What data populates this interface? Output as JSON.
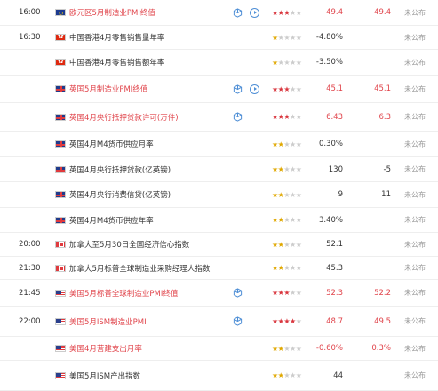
{
  "colors": {
    "accent_red": "#e0434a",
    "star_red": "#d9363e",
    "star_yellow": "#e0a800",
    "icon_blue": "#4f8fd6"
  },
  "rows": [
    {
      "time": "16:00",
      "flag": "eu",
      "name": "欧元区5月制造业PMI终值",
      "highlight": true,
      "icons": [
        "cube",
        "play"
      ],
      "stars": 3,
      "star_color": "red",
      "prev": "49.4",
      "fore": "49.4",
      "actual": "未公布"
    },
    {
      "time": "16:30",
      "flag": "hk",
      "name": "中国香港4月零售销售量年率",
      "highlight": false,
      "icons": [],
      "stars": 1,
      "star_color": "yellow",
      "prev": "-4.80%",
      "fore": "",
      "actual": "未公布"
    },
    {
      "time": "",
      "flag": "hk",
      "name": "中国香港4月零售销售额年率",
      "highlight": false,
      "icons": [],
      "stars": 1,
      "star_color": "yellow",
      "prev": "-3.50%",
      "fore": "",
      "actual": "未公布"
    },
    {
      "time": "",
      "flag": "uk",
      "name": "英国5月制造业PMI终值",
      "highlight": true,
      "icons": [
        "cube",
        "play"
      ],
      "stars": 3,
      "star_color": "red",
      "prev": "45.1",
      "fore": "45.1",
      "actual": "未公布"
    },
    {
      "time": "",
      "flag": "uk",
      "name": "英国4月央行抵押贷款许可(万件)",
      "highlight": true,
      "icons": [
        "cube"
      ],
      "stars": 3,
      "star_color": "red",
      "prev": "6.43",
      "fore": "6.3",
      "actual": "未公布"
    },
    {
      "time": "",
      "flag": "uk",
      "name": "英国4月M4货币供应月率",
      "highlight": false,
      "icons": [],
      "stars": 2,
      "star_color": "yellow",
      "prev": "0.30%",
      "fore": "",
      "actual": "未公布"
    },
    {
      "time": "",
      "flag": "uk",
      "name": "英国4月央行抵押贷款(亿英镑)",
      "highlight": false,
      "icons": [],
      "stars": 2,
      "star_color": "yellow",
      "prev": "130",
      "fore": "-5",
      "actual": "未公布"
    },
    {
      "time": "",
      "flag": "uk",
      "name": "英国4月央行消费信贷(亿英镑)",
      "highlight": false,
      "icons": [],
      "stars": 2,
      "star_color": "yellow",
      "prev": "9",
      "fore": "11",
      "actual": "未公布"
    },
    {
      "time": "",
      "flag": "uk",
      "name": "英国4月M4货币供应年率",
      "highlight": false,
      "icons": [],
      "stars": 2,
      "star_color": "yellow",
      "prev": "3.40%",
      "fore": "",
      "actual": "未公布"
    },
    {
      "time": "20:00",
      "flag": "ca",
      "name": "加拿大至5月30日全国经济信心指数",
      "highlight": false,
      "icons": [],
      "stars": 2,
      "star_color": "yellow",
      "prev": "52.1",
      "fore": "",
      "actual": "未公布"
    },
    {
      "time": "21:30",
      "flag": "ca",
      "name": "加拿大5月标普全球制造业采购经理人指数",
      "highlight": false,
      "icons": [],
      "stars": 2,
      "star_color": "yellow",
      "prev": "45.3",
      "fore": "",
      "actual": "未公布"
    },
    {
      "time": "21:45",
      "flag": "us",
      "name": "美国5月标普全球制造业PMI终值",
      "highlight": true,
      "icons": [
        "cube"
      ],
      "stars": 3,
      "star_color": "red",
      "prev": "52.3",
      "fore": "52.2",
      "actual": "未公布"
    },
    {
      "time": "22:00",
      "flag": "us",
      "name": "美国5月ISM制造业PMI",
      "highlight": true,
      "icons": [
        "cube"
      ],
      "stars": 4,
      "star_color": "red",
      "prev": "48.7",
      "fore": "49.5",
      "actual": "未公布"
    },
    {
      "time": "",
      "flag": "us",
      "name": "美国4月营建支出月率",
      "highlight": true,
      "icons": [],
      "stars": 2,
      "star_color": "yellow",
      "prev": "-0.60%",
      "fore": "0.3%",
      "actual": "未公布"
    },
    {
      "time": "",
      "flag": "us",
      "name": "美国5月ISM产出指数",
      "highlight": false,
      "icons": [],
      "stars": 2,
      "star_color": "yellow",
      "prev": "44",
      "fore": "",
      "actual": "未公布"
    }
  ]
}
